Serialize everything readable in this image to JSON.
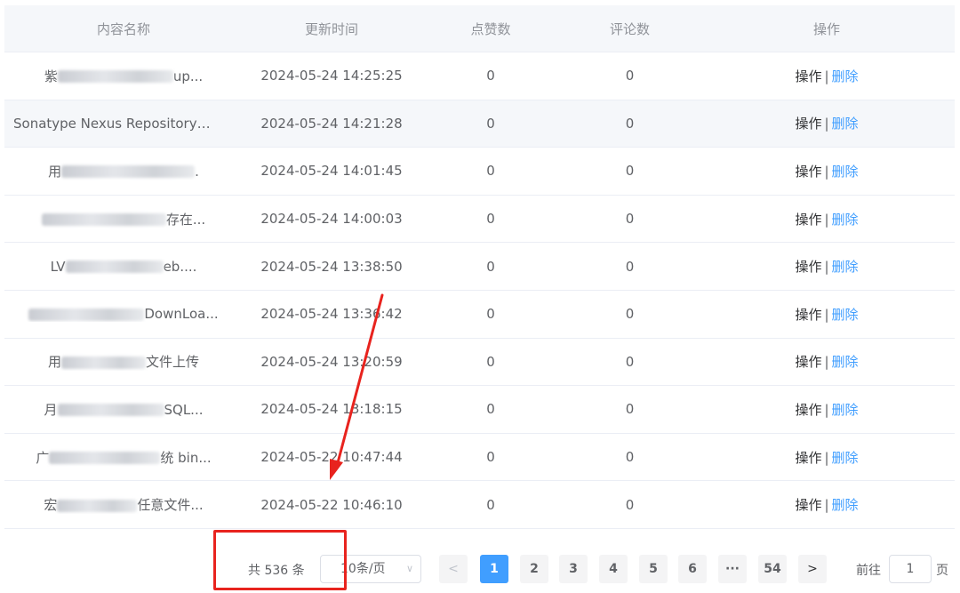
{
  "table": {
    "headers": [
      "内容名称",
      "更新时间",
      "点赞数",
      "评论数",
      "操作"
    ],
    "rows": [
      {
        "name_prefix": "紫",
        "name_suffix": "up...",
        "time": "2024-05-24 14:25:25",
        "likes": "0",
        "comments": "0"
      },
      {
        "name_prefix": "Sonatype Nexus Repository",
        "name_suffix": "...",
        "time": "2024-05-24 14:21:28",
        "likes": "0",
        "comments": "0"
      },
      {
        "name_prefix": "用",
        "name_suffix": ".",
        "time": "2024-05-24 14:01:45",
        "likes": "0",
        "comments": "0"
      },
      {
        "name_prefix": "",
        "name_suffix": "存在...",
        "time": "2024-05-24 14:00:03",
        "likes": "0",
        "comments": "0"
      },
      {
        "name_prefix": "LV",
        "name_suffix": "eb....",
        "time": "2024-05-24 13:38:50",
        "likes": "0",
        "comments": "0"
      },
      {
        "name_prefix": "",
        "name_suffix": "DownLoa...",
        "time": "2024-05-24 13:36:42",
        "likes": "0",
        "comments": "0"
      },
      {
        "name_prefix": "用",
        "name_suffix": "文件上传",
        "time": "2024-05-24 13:20:59",
        "likes": "0",
        "comments": "0"
      },
      {
        "name_prefix": "月",
        "name_suffix": "SQL...",
        "time": "2024-05-24 13:18:15",
        "likes": "0",
        "comments": "0"
      },
      {
        "name_prefix": "广",
        "name_suffix": "统 bin...",
        "time": "2024-05-22 10:47:44",
        "likes": "0",
        "comments": "0"
      },
      {
        "name_prefix": "宏",
        "name_suffix": "任意文件...",
        "time": "2024-05-22 10:46:10",
        "likes": "0",
        "comments": "0"
      }
    ],
    "op_label": "操作",
    "op_sep": "|",
    "delete_label": "删除"
  },
  "pagination": {
    "total_text": "共 536 条",
    "page_size": "10条/页",
    "prev": "<",
    "next": ">",
    "pages": [
      "1",
      "2",
      "3",
      "4",
      "5",
      "6",
      "···",
      "54"
    ],
    "current_page": "1",
    "goto_prefix": "前往",
    "goto_value": "1",
    "goto_suffix": "页"
  },
  "colors": {
    "primary": "#409eff",
    "annotation": "#e8231e"
  }
}
